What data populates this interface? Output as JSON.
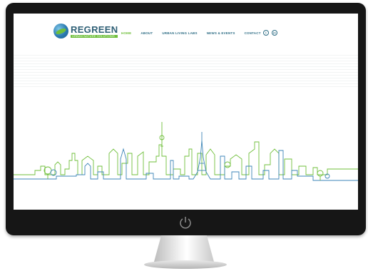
{
  "logo": {
    "brand": "REGREEN",
    "tagline": "URBAN NATURE SOLUTIONS"
  },
  "nav": {
    "items": [
      {
        "label": "HOME",
        "active": true
      },
      {
        "label": "ABOUT",
        "active": false
      },
      {
        "label": "URBAN LIVING LABS",
        "active": false
      },
      {
        "label": "NEWS & EVENTS",
        "active": false
      },
      {
        "label": "CONTACT",
        "active": false
      }
    ],
    "social": [
      {
        "icon": "twitter-icon",
        "glyph": "t"
      },
      {
        "icon": "linkedin-icon",
        "glyph": "in"
      }
    ]
  },
  "colors": {
    "accent_green": "#6fbf3a",
    "nav_blue": "#2e6d85",
    "skyline_green": "#6fbf3a",
    "skyline_blue": "#3e86b8"
  }
}
